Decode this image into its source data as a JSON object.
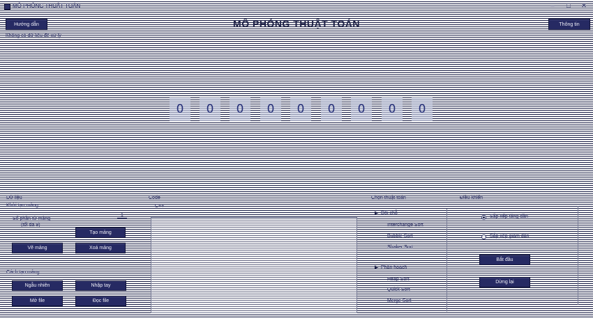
{
  "window": {
    "title": "MÔ PHỎNG THUẬT TOÁN",
    "controls": [
      "–",
      "□",
      "✕"
    ]
  },
  "header": {
    "guide_button": "Hướng dẫn",
    "info_button": "Thông tin",
    "title": "MÔ PHỎNG THUẬT TOÁN",
    "status": "Không có dữ liệu để xử lý"
  },
  "array": {
    "values": [
      "0",
      "0",
      "0",
      "0",
      "0",
      "0",
      "0",
      "0",
      "0"
    ]
  },
  "input_panel": {
    "heading": "Dữ liệu",
    "subheading": "Khởi tạo mảng",
    "size_label": "Số phần tử mảng",
    "size_hint": "(tối đa 9)",
    "size_value": "1",
    "create_button": "Tạo mảng",
    "draw_button": "Vẽ mảng",
    "clear_button": "Xoá mảng",
    "mode_heading": "Cách tạo mảng",
    "random_button": "Ngẫu nhiên",
    "manual_button": "Nhập tay",
    "open_file_button": "Mở file",
    "read_file_button": "Đọc file"
  },
  "code_panel": {
    "heading": "Code",
    "language": "C++"
  },
  "algo_panel": {
    "heading": "Chọn thuật toán",
    "group1": "Đổi chỗ",
    "group1_items": [
      "Interchange Sort",
      "Bubble Sort",
      "Shaker Sort"
    ],
    "group2": "Phân hoạch",
    "group2_items": [
      "Heap Sort",
      "Quick Sort",
      "Merge Sort"
    ]
  },
  "control_panel": {
    "heading": "Điều khiển",
    "ascending": "Sắp xếp tăng dần",
    "descending": "Sắp xếp giảm dần",
    "start_button": "Bắt đầu",
    "stop_button": "Dừng lại"
  },
  "colors": {
    "accent": "#262a63",
    "line": "#1c2048",
    "cell": "#c8cde1",
    "digit": "#26307a"
  }
}
